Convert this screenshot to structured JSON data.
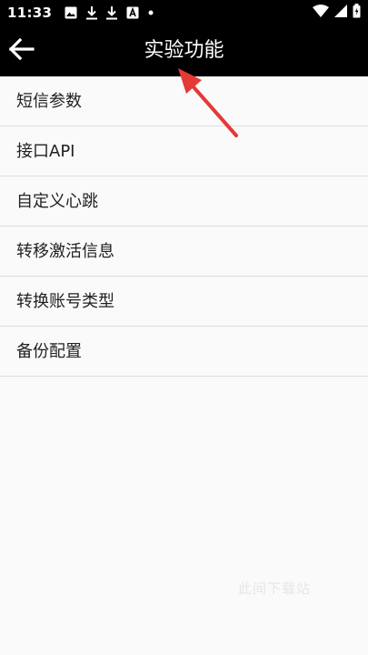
{
  "status_bar": {
    "time": "11:33",
    "left_icons": [
      "image-icon",
      "download-icon",
      "download-icon",
      "app-icon",
      "dot-icon"
    ],
    "right_icons": [
      "wifi-icon",
      "signal-icon",
      "battery-icon"
    ]
  },
  "toolbar": {
    "title": "实验功能",
    "back_icon": "arrow-left-icon"
  },
  "menu": {
    "items": [
      {
        "label": "短信参数"
      },
      {
        "label": "接口API"
      },
      {
        "label": "自定义心跳"
      },
      {
        "label": "转移激活信息"
      },
      {
        "label": "转换账号类型"
      },
      {
        "label": "备份配置"
      }
    ]
  },
  "watermark": {
    "text": "此间下载站"
  },
  "annotation": {
    "arrow_color": "#e53935"
  }
}
